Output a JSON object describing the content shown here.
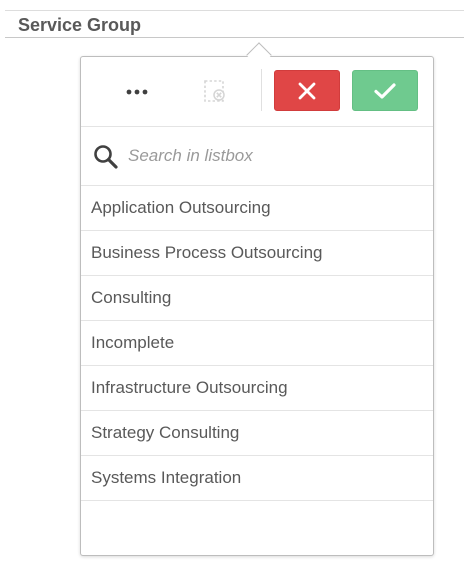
{
  "header": {
    "title": "Service Group"
  },
  "toolbar": {
    "more_icon": "more-horizontal-icon",
    "clear_icon": "clear-selection-icon",
    "cancel_icon": "close-icon",
    "confirm_icon": "check-icon",
    "colors": {
      "cancel": "#e04646",
      "confirm": "#6fca8f"
    }
  },
  "search": {
    "icon": "search-icon",
    "placeholder": "Search in listbox",
    "value": ""
  },
  "listbox": {
    "items": [
      {
        "label": "Application Outsourcing"
      },
      {
        "label": "Business Process Outsourcing"
      },
      {
        "label": "Consulting"
      },
      {
        "label": "Incomplete"
      },
      {
        "label": "Infrastructure Outsourcing"
      },
      {
        "label": "Strategy Consulting"
      },
      {
        "label": "Systems Integration"
      }
    ]
  }
}
